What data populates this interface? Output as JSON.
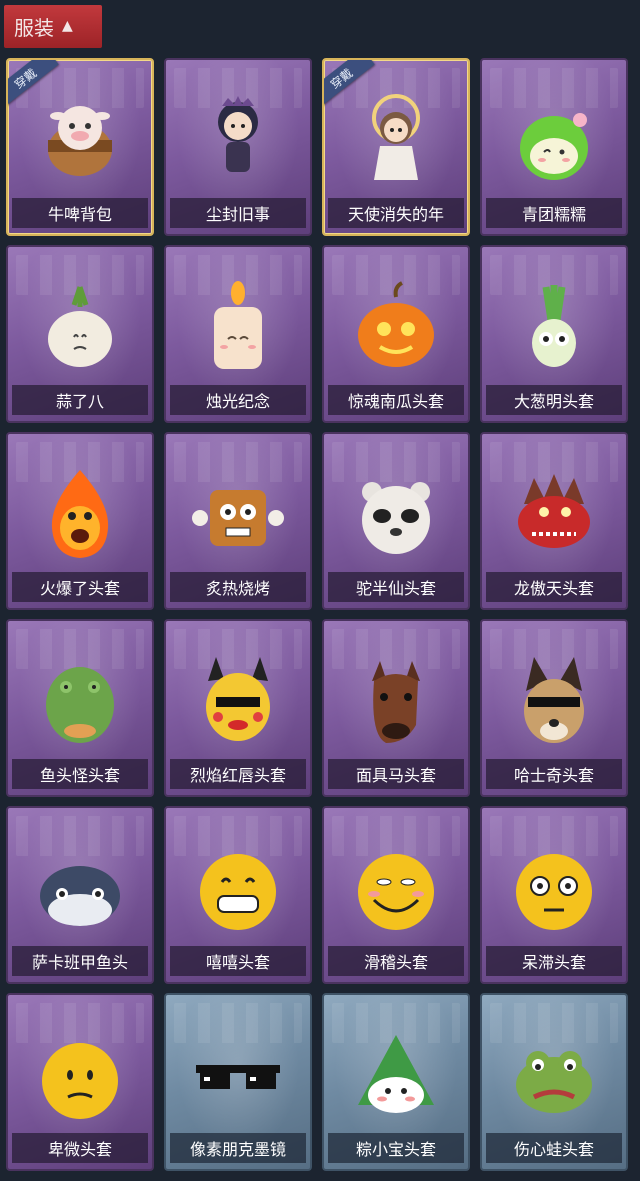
{
  "header": {
    "title": "服装"
  },
  "items": [
    {
      "name": "牛啤背包",
      "equipped_label": "穿戴",
      "equipped": true,
      "theme": "purple",
      "icon": "cow-beer-backpack"
    },
    {
      "name": "尘封旧事",
      "equipped": false,
      "theme": "purple",
      "icon": "chibi-character"
    },
    {
      "name": "天使消失的年",
      "equipped_label": "穿戴",
      "equipped": true,
      "theme": "purple",
      "icon": "angel-girl"
    },
    {
      "name": "青团糯糯",
      "equipped": false,
      "theme": "purple",
      "icon": "green-rice-ball"
    },
    {
      "name": "蒜了八",
      "equipped": false,
      "theme": "purple",
      "icon": "garlic"
    },
    {
      "name": "烛光纪念",
      "equipped": false,
      "theme": "purple",
      "icon": "candle"
    },
    {
      "name": "惊魂南瓜头套",
      "equipped": false,
      "theme": "purple",
      "icon": "pumpkin"
    },
    {
      "name": "大葱明头套",
      "equipped": false,
      "theme": "purple",
      "icon": "scallion"
    },
    {
      "name": "火爆了头套",
      "equipped": false,
      "theme": "purple",
      "icon": "fireball"
    },
    {
      "name": "炙热烧烤",
      "equipped": false,
      "theme": "purple",
      "icon": "bbq-meat"
    },
    {
      "name": "驼半仙头套",
      "equipped": false,
      "theme": "purple",
      "icon": "panda-bear"
    },
    {
      "name": "龙傲天头套",
      "equipped": false,
      "theme": "purple",
      "icon": "dragon"
    },
    {
      "name": "鱼头怪头套",
      "equipped": false,
      "theme": "purple",
      "icon": "fish-head"
    },
    {
      "name": "烈焰红唇头套",
      "equipped": false,
      "theme": "purple",
      "icon": "yellow-mask"
    },
    {
      "name": "面具马头套",
      "equipped": false,
      "theme": "purple",
      "icon": "horse-head"
    },
    {
      "name": "哈士奇头套",
      "equipped": false,
      "theme": "purple",
      "icon": "husky-head"
    },
    {
      "name": "萨卡班甲鱼头",
      "equipped": false,
      "theme": "purple",
      "icon": "sacabambaspis"
    },
    {
      "name": "嘻嘻头套",
      "equipped": false,
      "theme": "purple",
      "icon": "grin-emoji"
    },
    {
      "name": "滑稽头套",
      "equipped": false,
      "theme": "purple",
      "icon": "funny-emoji"
    },
    {
      "name": "呆滞头套",
      "equipped": false,
      "theme": "purple",
      "icon": "dazed-emoji"
    },
    {
      "name": "卑微头套",
      "equipped": false,
      "theme": "purple",
      "icon": "humble-emoji"
    },
    {
      "name": "像素朋克墨镜",
      "equipped": false,
      "theme": "blue",
      "icon": "pixel-sunglasses"
    },
    {
      "name": "粽小宝头套",
      "equipped": false,
      "theme": "blue",
      "icon": "zongzi"
    },
    {
      "name": "伤心蛙头套",
      "equipped": false,
      "theme": "blue",
      "icon": "sad-frog"
    }
  ]
}
